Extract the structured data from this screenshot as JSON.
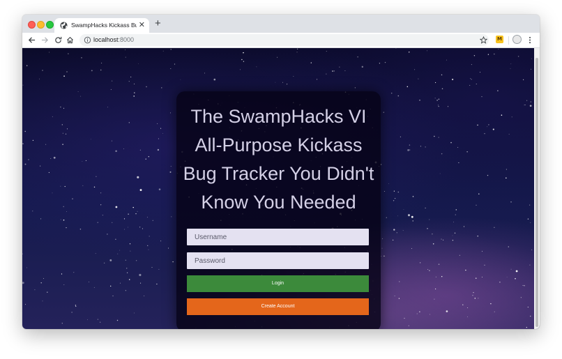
{
  "browser": {
    "tab_title": "SwampHacks Kickass Bug Track",
    "tab_close": "✕",
    "new_tab": "+",
    "url_host": "localhost",
    "url_port": ":8000",
    "extension_letter": "M",
    "back_icon": "arrow-left",
    "forward_icon": "arrow-right",
    "reload_icon": "reload",
    "home_icon": "home",
    "star_icon": "star",
    "menu_icon": "kebab-menu"
  },
  "login": {
    "title": "The SwampHacks VI All-Purpose Kickass Bug Tracker You Didn't Know You Needed",
    "username_placeholder": "Username",
    "password_placeholder": "Password",
    "login_label": "Login",
    "create_label": "Create Account"
  },
  "colors": {
    "login_button": "#3c8a3b",
    "create_button": "#e4661b",
    "input_bg": "#e4e1f1",
    "title_text": "#d4d0e6"
  }
}
